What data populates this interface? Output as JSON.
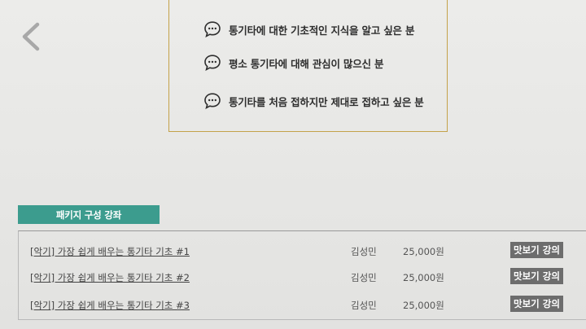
{
  "navigation": {
    "back_icon": "chevron-left-icon"
  },
  "target_audience": {
    "icon": "speech-bubble-icon",
    "items": [
      {
        "label": "통기타에 대한 기초적인 지식을 알고 싶은 분"
      },
      {
        "label": "평소 통기타에 대해 관심이 많으신 분"
      },
      {
        "label": "통기타를 처음 접하지만 제대로 접하고 싶은 분"
      }
    ],
    "border_color": "#c4a24a"
  },
  "package": {
    "tab_label": "패키지 구성 강좌",
    "tab_color": "#3c9c8e",
    "courses": [
      {
        "title": "[악기] 가장 쉽게 배우는 통기타 기초 #1",
        "instructor": "김성민",
        "price": "25,000원",
        "preview_label": "맛보기 강의"
      },
      {
        "title": "[악기] 가장 쉽게 배우는 통기타 기초 #2",
        "instructor": "김성민",
        "price": "25,000원",
        "preview_label": "맛보기 강의"
      },
      {
        "title": "[악기] 가장 쉽게 배우는 통기타 기초 #3",
        "instructor": "김성민",
        "price": "25,000원",
        "preview_label": "맛보기 강의"
      }
    ]
  }
}
